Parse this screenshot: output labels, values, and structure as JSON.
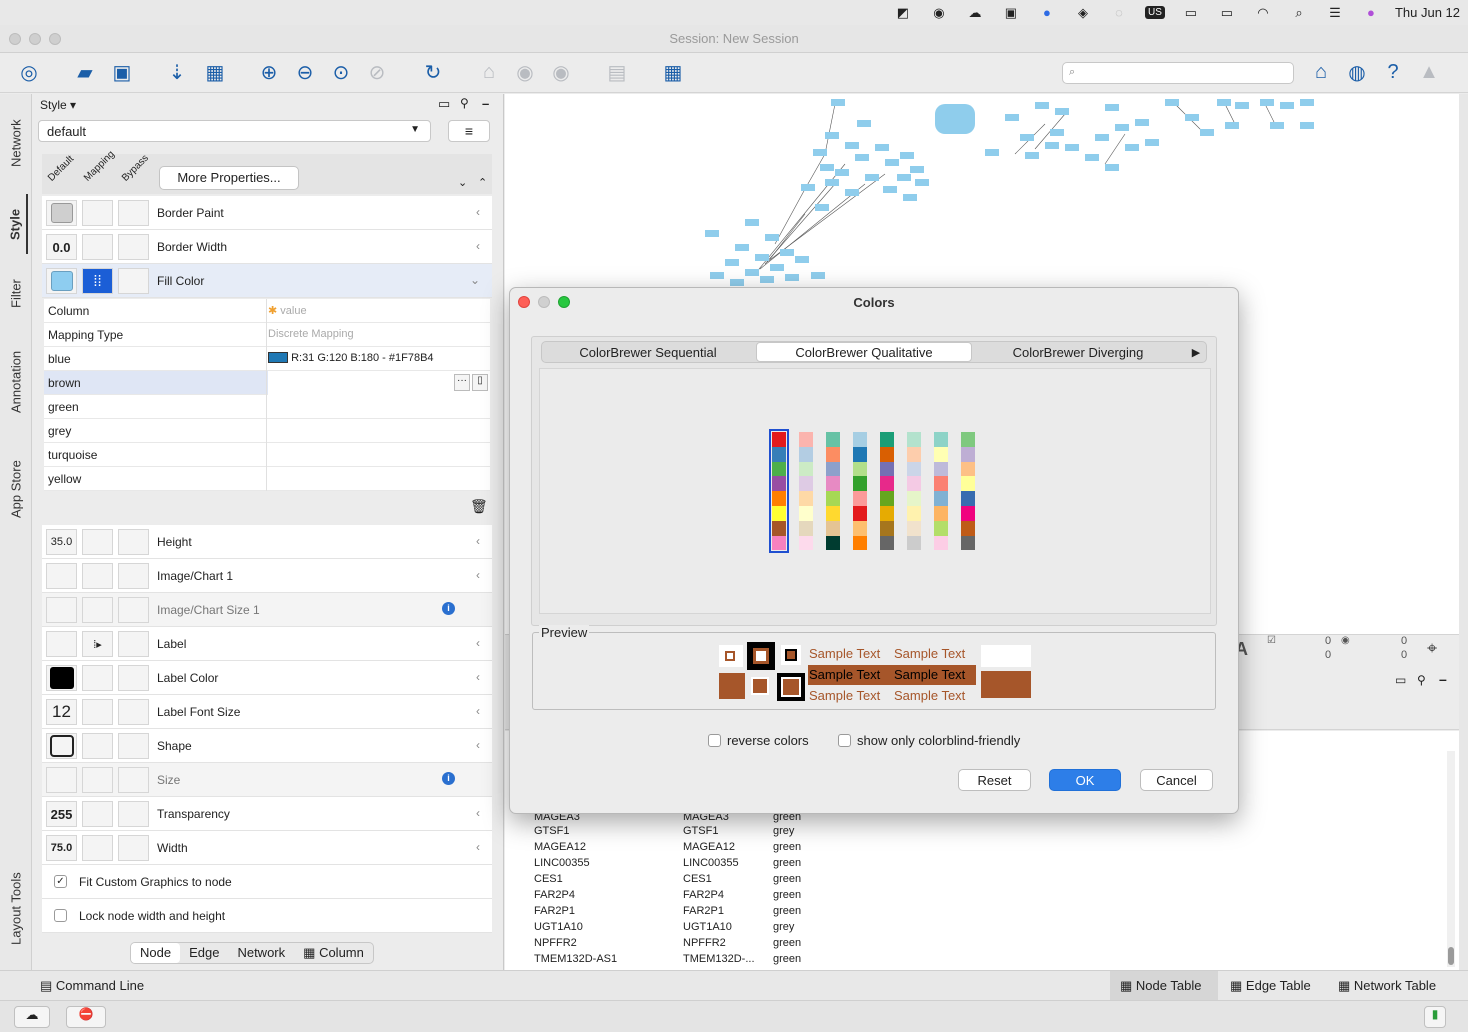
{
  "menubar": {
    "clock": "Thu Jun 12",
    "icons": [
      "drive-icon",
      "sync-icon",
      "cloud-icon",
      "office-icon",
      "zoom-icon",
      "teams-icon",
      "spiral-icon"
    ],
    "input_source": "US"
  },
  "window": {
    "title": "Session: New Session"
  },
  "toolbar": {
    "search_placeholder": ""
  },
  "vtabs": {
    "network": "Network",
    "style": "Style",
    "filter": "Filter",
    "annotation": "Annotation",
    "app_store": "App Store",
    "layout_tools": "Layout Tools"
  },
  "style_panel": {
    "header": "Style",
    "style_select": "default",
    "col_default": "Default",
    "col_mapping": "Mapping",
    "col_bypass": "Bypass",
    "more_props": "More Properties...",
    "props_top": [
      {
        "label": "Border Paint",
        "default": ""
      },
      {
        "label": "Border Width",
        "default": "0.0"
      },
      {
        "label": "Fill Color",
        "default": ""
      }
    ],
    "mapping": {
      "column_label": "Column",
      "column_value": "value",
      "type_label": "Mapping Type",
      "type_value": "Discrete Mapping",
      "entries": [
        {
          "key": "blue",
          "value": "R:31 G:120 B:180 - #1F78B4"
        },
        {
          "key": "brown",
          "value": ""
        },
        {
          "key": "green",
          "value": ""
        },
        {
          "key": "grey",
          "value": ""
        },
        {
          "key": "turquoise",
          "value": ""
        },
        {
          "key": "yellow",
          "value": ""
        }
      ]
    },
    "props_bottom": [
      {
        "label": "Height",
        "default": "35.0"
      },
      {
        "label": "Image/Chart 1",
        "default": ""
      },
      {
        "label": "Image/Chart Size 1",
        "default": ""
      },
      {
        "label": "Label",
        "default": ""
      },
      {
        "label": "Label Color",
        "default": ""
      },
      {
        "label": "Label Font Size",
        "default": "12"
      },
      {
        "label": "Shape",
        "default": ""
      },
      {
        "label": "Size",
        "default": ""
      },
      {
        "label": "Transparency",
        "default": "255"
      },
      {
        "label": "Width",
        "default": "75.0"
      }
    ],
    "fit_custom": "Fit Custom Graphics to node",
    "lock_size": "Lock node width and height",
    "tabs": [
      "Node",
      "Edge",
      "Network",
      "Column"
    ]
  },
  "colors_dialog": {
    "title": "Colors",
    "tabs": [
      "ColorBrewer Sequential",
      "ColorBrewer Qualitative",
      "ColorBrewer Diverging"
    ],
    "active_tab": "ColorBrewer Qualitative",
    "palettes": [
      [
        "#E41A1C",
        "#377EB8",
        "#4DAF4A",
        "#984EA3",
        "#FF7F00",
        "#FFFF33",
        "#A65628",
        "#F781BF"
      ],
      [
        "#FBB4AE",
        "#B3CDE3",
        "#CCEBC5",
        "#DECBE4",
        "#FED9A6",
        "#FFFFCC",
        "#E5D8BD",
        "#FDDAEC"
      ],
      [
        "#66C2A5",
        "#FC8D62",
        "#8DA0CB",
        "#E78AC3",
        "#A6D854",
        "#FFD92F",
        "#E5C494",
        "#003C30"
      ],
      [
        "#A6CEE3",
        "#1F78B4",
        "#B2DF8A",
        "#33A02C",
        "#FB9A99",
        "#E31A1C",
        "#FDBF6F",
        "#FF7F00"
      ],
      [
        "#1B9E77",
        "#D95F02",
        "#7570B3",
        "#E7298A",
        "#66A61E",
        "#E6AB02",
        "#A6761D",
        "#666666"
      ],
      [
        "#B3E2CD",
        "#FDCDAC",
        "#CBD5E8",
        "#F4CAE4",
        "#E6F5C9",
        "#FFF2AE",
        "#F1E2CC",
        "#CCCCCC"
      ],
      [
        "#8DD3C7",
        "#FFFFB3",
        "#BEBADA",
        "#FB8072",
        "#80B1D3",
        "#FDB462",
        "#B3DE69",
        "#FCCDE5"
      ],
      [
        "#7FC97F",
        "#BEAED4",
        "#FDC086",
        "#FFFF99",
        "#386CB0",
        "#F0027F",
        "#BF5B17",
        "#666666"
      ]
    ],
    "preview_label": "Preview",
    "preview_color": "#A6562A",
    "sample_text": "Sample Text",
    "reverse_colors": "reverse colors",
    "colorblind": "show only colorblind-friendly",
    "reset": "Reset",
    "ok": "OK",
    "cancel": "Cancel"
  },
  "node_table": {
    "rows": [
      [
        "MAGEA3",
        "MAGEA3",
        "green"
      ],
      [
        "GTSF1",
        "GTSF1",
        "grey"
      ],
      [
        "MAGEA12",
        "MAGEA12",
        "green"
      ],
      [
        "LINC00355",
        "LINC00355",
        "green"
      ],
      [
        "CES1",
        "CES1",
        "green"
      ],
      [
        "FAR2P4",
        "FAR2P4",
        "green"
      ],
      [
        "FAR2P1",
        "FAR2P1",
        "green"
      ],
      [
        "UGT1A10",
        "UGT1A10",
        "grey"
      ],
      [
        "NPFFR2",
        "NPFFR2",
        "green"
      ],
      [
        "TMEM132D-AS1",
        "TMEM132D-...",
        "green"
      ]
    ]
  },
  "status": {
    "command_line": "Command Line",
    "tabs": [
      "Node Table",
      "Edge Table",
      "Network Table"
    ],
    "counts": [
      "0",
      "0",
      "0",
      "0"
    ]
  }
}
